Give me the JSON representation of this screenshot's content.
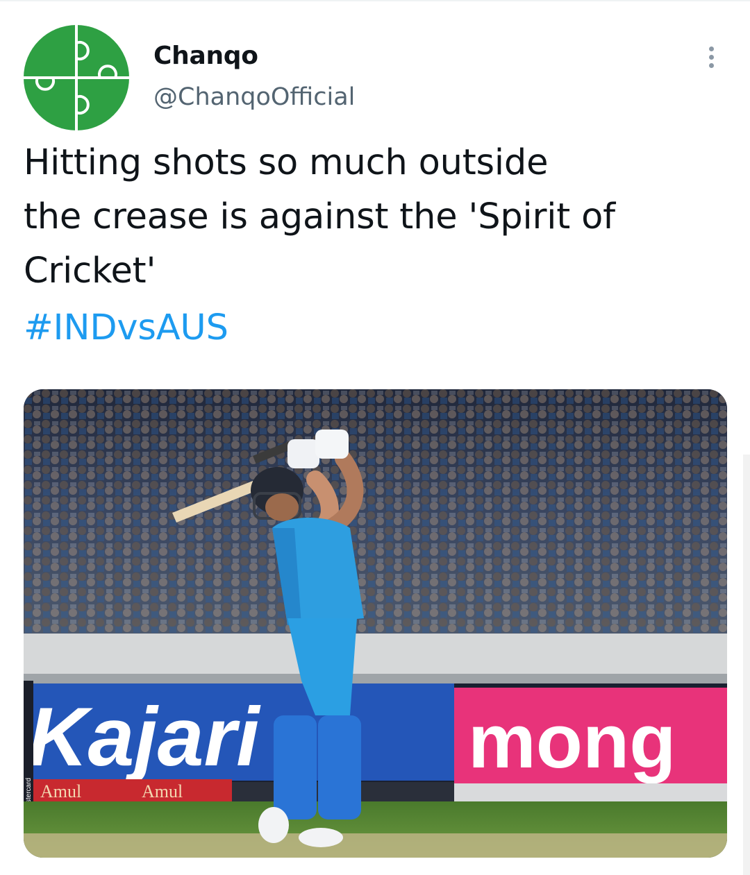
{
  "tweet": {
    "author": {
      "display_name": "Chanqo",
      "handle": "@ChanqoOfficial",
      "avatar_icon": "green-puzzle-logo-icon",
      "avatar_color": "#2ea043"
    },
    "more_icon": "more-options-icon",
    "text": "Hitting shots so much outside\nthe crease is against the 'Spirit of\nCricket'",
    "hashtag": "#INDvsAUS",
    "link_color": "#1d9bf0",
    "media": {
      "type": "photo",
      "signage": {
        "left_board": "Kajari",
        "right_board": "mong",
        "lower_board": "Amul",
        "side_strip": "mastercard"
      }
    }
  }
}
